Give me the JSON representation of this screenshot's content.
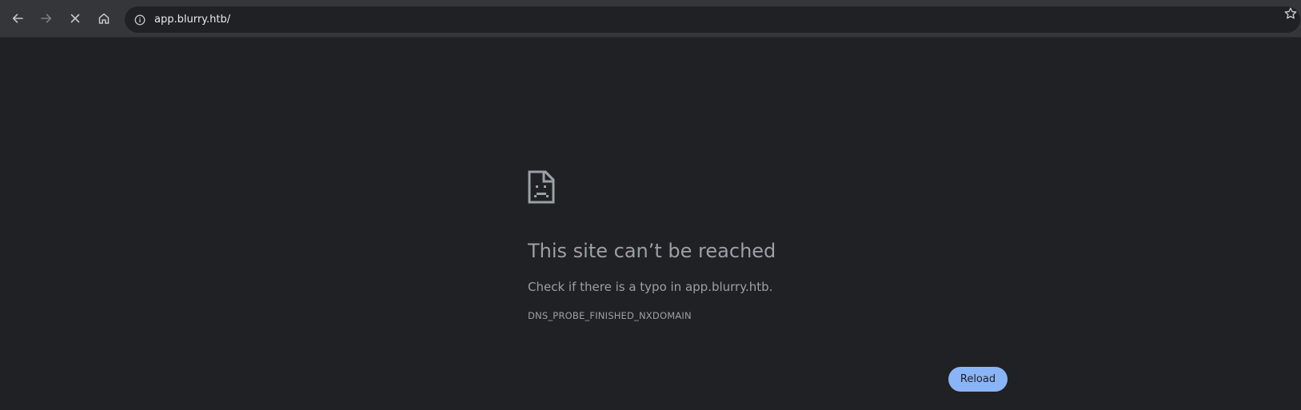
{
  "browser": {
    "url": "app.blurry.htb/",
    "icons": {
      "back": "arrow-left-icon",
      "forward": "arrow-right-icon",
      "stop": "close-icon",
      "home": "home-icon",
      "site_info": "info-icon",
      "bookmark": "star-icon"
    }
  },
  "error_page": {
    "icon": "sad-page-icon",
    "headline": "This site can’t be reached",
    "suggestion": "Check if there is a typo in app.blurry.htb.",
    "error_code": "DNS_PROBE_FINISHED_NXDOMAIN",
    "reload_label": "Reload"
  },
  "colors": {
    "background": "#202124",
    "toolbar": "#35363a",
    "text": "#9aa0a6",
    "button": "#8ab4f8"
  }
}
